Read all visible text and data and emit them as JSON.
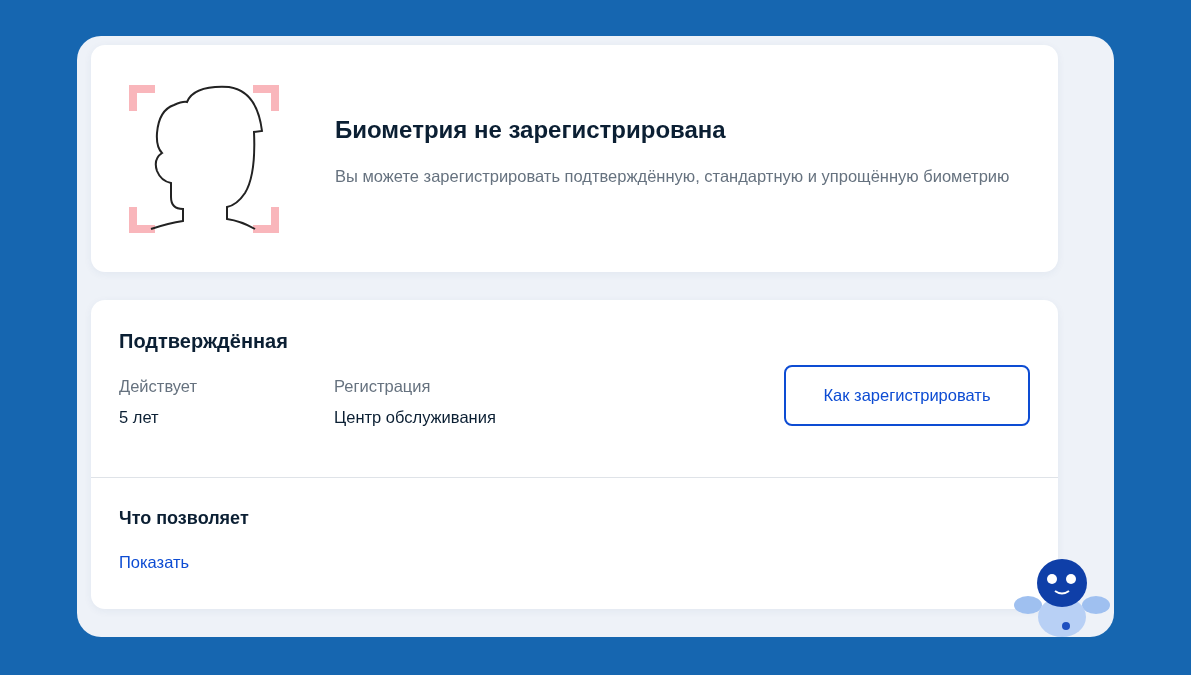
{
  "status_card": {
    "title": "Биометрия не зарегистрирована",
    "description": "Вы можете зарегистрировать подтверждённую, стандартную и упрощённую биометрию"
  },
  "biometry_card": {
    "title": "Подтверждённая",
    "fields": [
      {
        "label": "Действует",
        "value": "5 лет"
      },
      {
        "label": "Регистрация",
        "value": "Центр обслуживания"
      }
    ],
    "button": "Как зарегистрировать",
    "section_title": "Что позволяет",
    "link": "Показать"
  }
}
